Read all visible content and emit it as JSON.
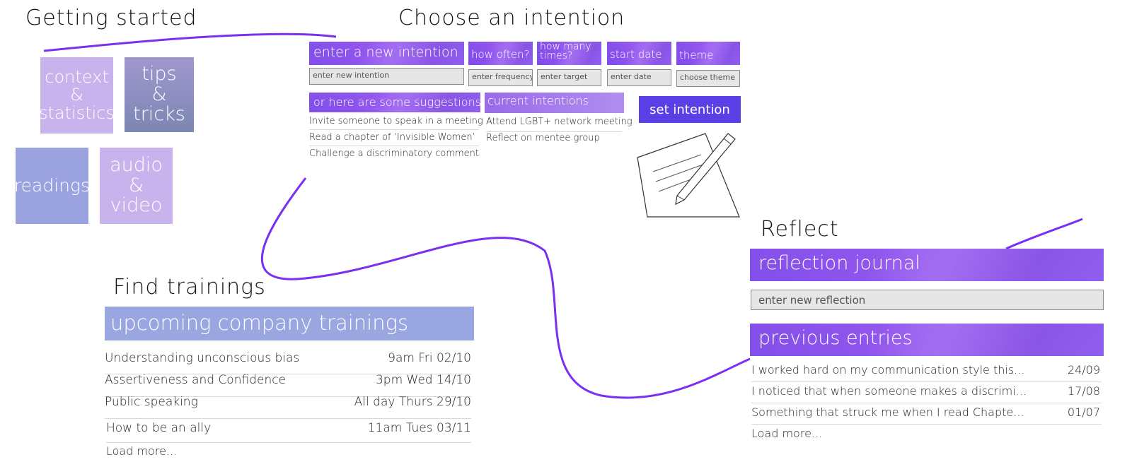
{
  "getting_started": {
    "title": "Getting started",
    "tiles": {
      "context": "context & statistics",
      "tips_line1": "tips",
      "tips_line2": "&",
      "tips_line3": "tricks",
      "readings": "readings",
      "audio_line1": "audio",
      "audio_line2": "&",
      "audio_line3": "video"
    },
    "context_line1": "context &",
    "context_line2": "statistics"
  },
  "intention": {
    "title": "Choose an intention",
    "headers": {
      "new": "enter a new intention",
      "often": "how often?",
      "times_line1": "how many",
      "times_line2": "times?",
      "start": "start date",
      "theme": "theme"
    },
    "placeholders": {
      "new": "enter new intention",
      "often": "enter frequency",
      "times": "enter target",
      "start": "enter date",
      "theme": "choose theme"
    },
    "suggestions_header": "or here are some suggestions",
    "suggestions": [
      "Invite someone to speak in a meeting",
      "Read a chapter of ‘Invisible Women’",
      "Challenge a discriminatory comment"
    ],
    "current_header": "current intentions",
    "current": [
      "Attend LGBT+ network meeting",
      "Reflect on mentee group"
    ],
    "set_button": "set intention"
  },
  "trainings": {
    "title": "Find trainings",
    "header": "upcoming company trainings",
    "rows": [
      {
        "name": "Understanding unconscious bias",
        "when": "9am Fri 02/10"
      },
      {
        "name": "Assertiveness and Confidence",
        "when": "3pm Wed 14/10"
      },
      {
        "name": "Public speaking",
        "when": "All day Thurs 29/10"
      },
      {
        "name": "How to be an ally",
        "when": "11am Tues 03/11"
      }
    ],
    "load_more": "Load more..."
  },
  "reflect": {
    "title": "Reflect",
    "journal_header": "reflection journal",
    "placeholder": "enter new reflection",
    "previous_header": "previous entries",
    "entries": [
      {
        "text": "I worked hard on my communication style this...",
        "date": "24/09"
      },
      {
        "text": "I noticed that when someone makes a discrimi...",
        "date": "17/08"
      },
      {
        "text": "Something that struck me when I read Chapte...",
        "date": "01/07"
      }
    ],
    "load_more": "Load more..."
  },
  "colors": {
    "purple_light": "#c9b3ec",
    "slate": "#8b8fbb",
    "periwinkle": "#9aa3e0",
    "accent": "#7b3fe4",
    "button": "#5b3ee4",
    "training_header": "#9aa6e0"
  }
}
